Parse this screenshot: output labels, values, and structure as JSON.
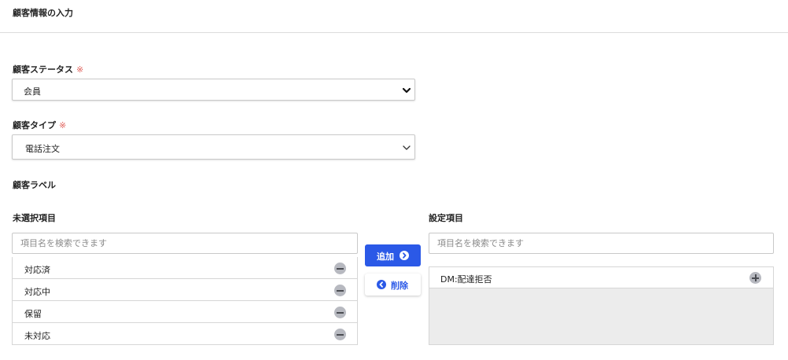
{
  "page": {
    "title": "顧客情報の入力"
  },
  "form": {
    "required_mark": "※",
    "status": {
      "label": "顧客ステータス",
      "value": "会員"
    },
    "type": {
      "label": "顧客タイプ",
      "value": "電話注文"
    },
    "labels_section": "顧客ラベル"
  },
  "unselected": {
    "title": "未選択項目",
    "search_placeholder": "項目名を検索できます",
    "items": [
      "対応済",
      "対応中",
      "保留",
      "未対応"
    ]
  },
  "selected": {
    "title": "設定項目",
    "search_placeholder": "項目名を検索できます",
    "items": [
      "DM:配達拒否"
    ]
  },
  "actions": {
    "add_label": "追加",
    "remove_label": "削除"
  },
  "colors": {
    "accent": "#2b59e7",
    "required": "#e0605a"
  }
}
